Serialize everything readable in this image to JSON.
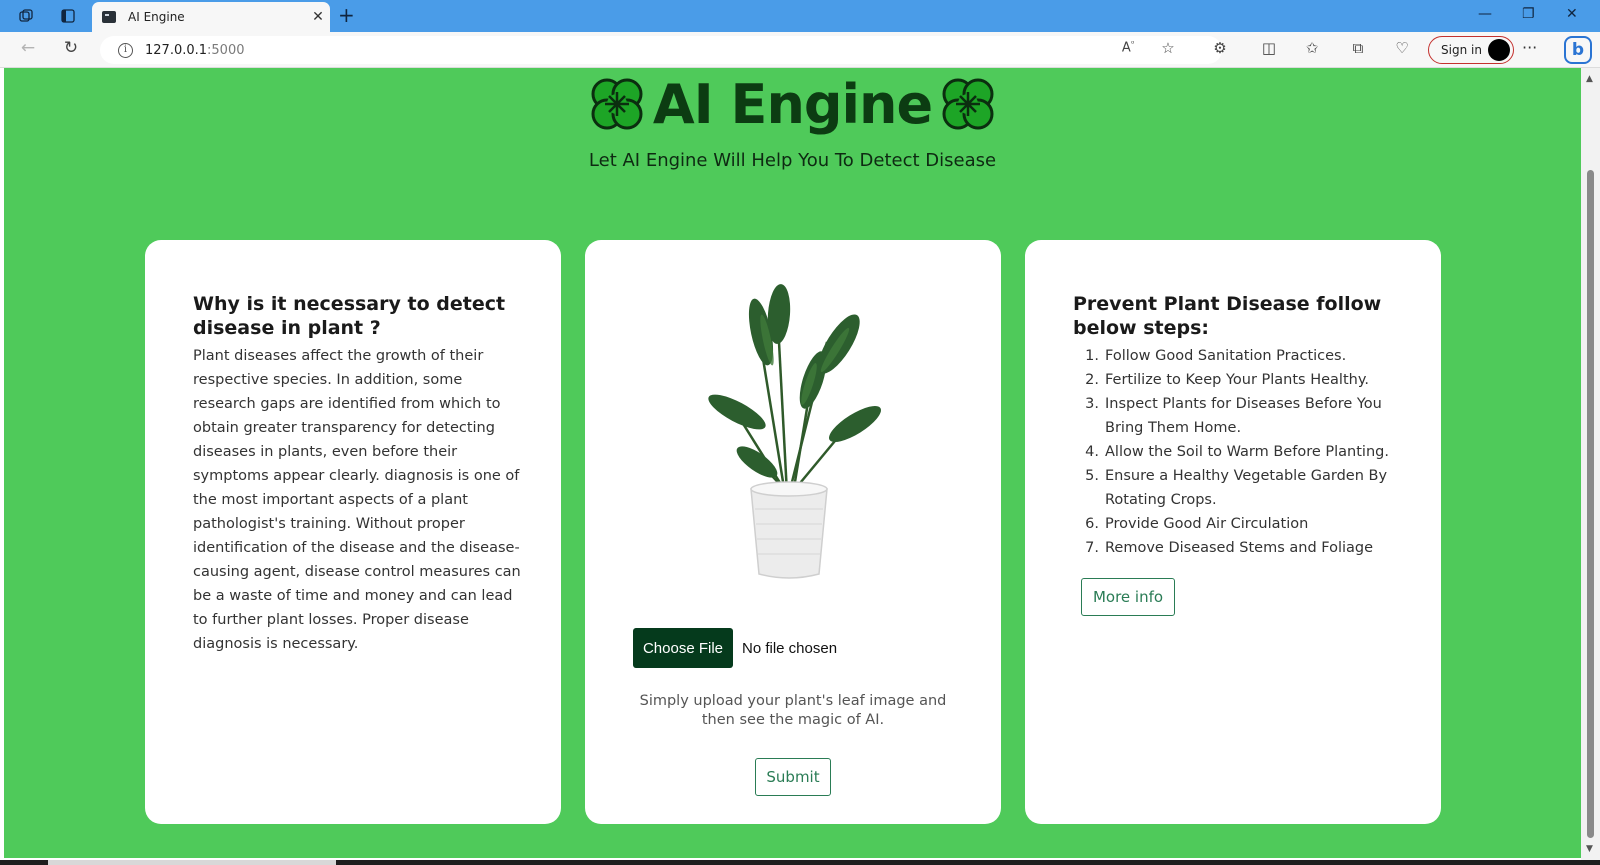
{
  "browser": {
    "tab_title": "AI Engine",
    "url_host": "127.0.0.1",
    "url_port": ":5000",
    "signin_label": "Sign in"
  },
  "header": {
    "title": "AI Engine",
    "tagline": "Let AI Engine Will Help You To Detect Disease"
  },
  "left_card": {
    "heading": "Why is it necessary to detect disease in plant ?",
    "body": "Plant diseases affect the growth of their respective species. In addition, some research gaps are identified from which to obtain greater transparency for detecting diseases in plants, even before their symptoms appear clearly. diagnosis is one of the most important aspects of a plant pathologist's training. Without proper identification of the disease and the disease-causing agent, disease control measures can be a waste of time and money and can lead to further plant losses. Proper disease diagnosis is necessary."
  },
  "middle_card": {
    "choose_file_label": "Choose File",
    "file_status": "No file chosen",
    "upload_hint": "Simply upload your plant's leaf image and then see the magic of AI.",
    "submit_label": "Submit"
  },
  "right_card": {
    "heading": "Prevent Plant Disease follow below steps:",
    "steps": [
      {
        "num": "1.",
        "text": "Follow Good Sanitation Practices."
      },
      {
        "num": "2.",
        "text": "Fertilize to Keep Your Plants Healthy."
      },
      {
        "num": "3.",
        "text": "Inspect Plants for Diseases Before You Bring Them Home."
      },
      {
        "num": "4.",
        "text": "Allow the Soil to Warm Before Planting."
      },
      {
        "num": "5.",
        "text": "Ensure a Healthy Vegetable Garden By Rotating Crops."
      },
      {
        "num": "6.",
        "text": "Provide Good Air Circulation"
      },
      {
        "num": "7.",
        "text": "Remove Diseased Stems and Foliage"
      }
    ],
    "more_info_label": "More info"
  },
  "colors": {
    "page_background": "#4fca5a",
    "brand_text": "#0c3c12",
    "accent_outline": "#2a7c55",
    "choose_button": "#053a1c",
    "browser_titlebar": "#4a9ce8"
  },
  "icons": [
    "workspaces-icon",
    "tab-actions-icon",
    "back-icon",
    "refresh-icon",
    "info-icon",
    "read-aloud-icon",
    "favorite-icon",
    "extensions-icon",
    "split-screen-icon",
    "favorites-icon",
    "collections-icon",
    "browser-essentials-icon",
    "more-icon",
    "bing-chat-icon",
    "clover-icon"
  ]
}
